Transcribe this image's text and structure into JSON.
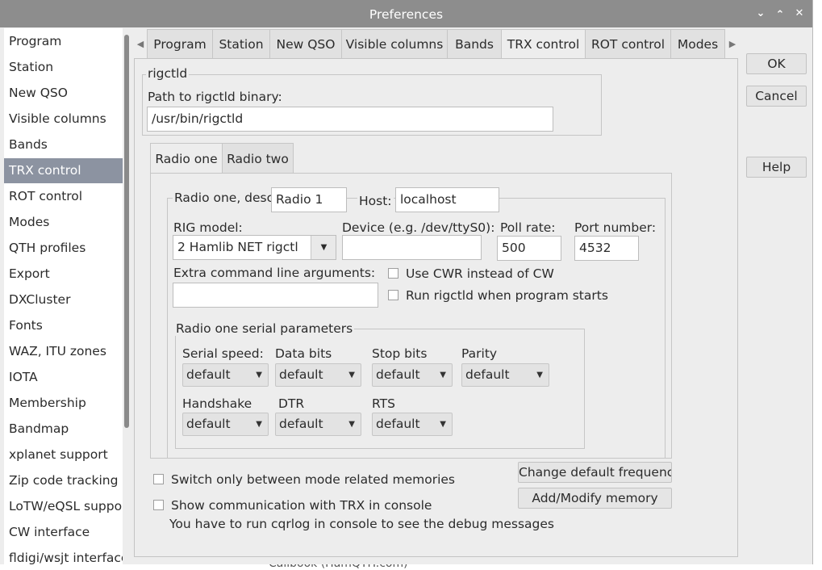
{
  "window": {
    "title": "Preferences"
  },
  "sidebar": {
    "items": [
      {
        "label": "Program"
      },
      {
        "label": "Station"
      },
      {
        "label": "New QSO"
      },
      {
        "label": "Visible columns"
      },
      {
        "label": "Bands"
      },
      {
        "label": "TRX control"
      },
      {
        "label": "ROT control"
      },
      {
        "label": "Modes"
      },
      {
        "label": "QTH profiles"
      },
      {
        "label": "Export"
      },
      {
        "label": "DXCluster"
      },
      {
        "label": "Fonts"
      },
      {
        "label": "WAZ, ITU zones"
      },
      {
        "label": "IOTA"
      },
      {
        "label": "Membership"
      },
      {
        "label": "Bandmap"
      },
      {
        "label": "xplanet support"
      },
      {
        "label": "Zip code tracking"
      },
      {
        "label": "LoTW/eQSL support"
      },
      {
        "label": "CW interface"
      },
      {
        "label": "fldigi/wsjt interface"
      }
    ],
    "selected": "TRX control"
  },
  "tabs": [
    "Program",
    "Station",
    "New QSO",
    "Visible columns",
    "Bands",
    "TRX control",
    "ROT control",
    "Modes"
  ],
  "active_tab": "TRX control",
  "dialog_buttons": {
    "ok": "OK",
    "cancel": "Cancel",
    "help": "Help"
  },
  "rigctld": {
    "group_title": "rigctld",
    "path_label": "Path to rigctld binary:",
    "path_value": "/usr/bin/rigctld"
  },
  "radio_tabs": [
    "Radio one",
    "Radio two"
  ],
  "radio_one": {
    "desc_label": "Radio one, desc.:",
    "desc_value": "Radio 1",
    "host_label": "Host:",
    "host_value": "localhost",
    "rig_model_label": "RIG model:",
    "rig_model_value": "2 Hamlib NET rigctl",
    "device_label": "Device (e.g. /dev/ttyS0):",
    "device_value": "",
    "poll_rate_label": "Poll rate:",
    "poll_rate_value": "500",
    "port_label": "Port number:",
    "port_value": "4532",
    "extra_args_label": "Extra command line arguments:",
    "extra_args_value": "",
    "use_cwr_label": "Use CWR instead of CW",
    "run_rigctld_label": "Run rigctld when program starts",
    "serial": {
      "title": "Radio one serial parameters",
      "serial_speed_label": "Serial speed:",
      "data_bits_label": "Data bits",
      "stop_bits_label": "Stop bits",
      "parity_label": "Parity",
      "handshake_label": "Handshake",
      "dtr_label": "DTR",
      "rts_label": "RTS",
      "serial_speed_value": "default",
      "data_bits_value": "default",
      "stop_bits_value": "default",
      "parity_value": "default",
      "handshake_value": "default",
      "dtr_value": "default",
      "rts_value": "default"
    }
  },
  "bottom": {
    "switch_memories_label": "Switch only between mode related memories",
    "show_comm_label": "Show communication with TRX in console",
    "debug_note": "You have to run cqrlog in console to see the debug messages",
    "change_freq_button": "Change default frequencies",
    "add_memory_button": "Add/Modify memory"
  },
  "background": {
    "partial_text": "Callbook (HamQTH.com)"
  },
  "icons": {
    "minimize": "chevron-down-icon",
    "maximize": "chevron-up-icon",
    "close": "close-icon"
  }
}
